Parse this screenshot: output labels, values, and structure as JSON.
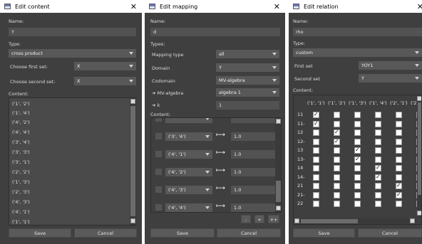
{
  "win1": {
    "title": "Edit content",
    "close": "✕",
    "name_label": "Name:",
    "name_value": "Y",
    "type_label": "Type:",
    "type_value": "cross product",
    "first_set_label": "Choose first set:",
    "first_set_value": "X",
    "second_set_label": "Choose second set:",
    "second_set_value": "X",
    "content_label": "Content:",
    "items": [
      "('1', '2')",
      "('1', '4')",
      "('4', '2')",
      "('4', '4')",
      "('3', '4')",
      "('3', '3')",
      "('3', '1')",
      "('2', '2')",
      "('1', '3')",
      "('2', '3')",
      "('4', '3')",
      "('4', '1')",
      "('1', '1')"
    ],
    "save": "Save",
    "cancel": "Cancel"
  },
  "win2": {
    "title": "Edit mapping",
    "close": "✕",
    "name_label": "Name:",
    "name_value": "d",
    "types_label": "Types:",
    "mapping_type_label": "Mapping type",
    "mapping_type_value": "all",
    "domain_label": "Domain",
    "domain_value": "Y",
    "codomain_label": "Codomain",
    "codomain_value": "MV-algebra",
    "mv_label": "➔ MV-algebra",
    "mv_value": "algebra 1",
    "k_label": "➔ k",
    "k_value": "1",
    "content_label": "Content:",
    "rows": [
      {
        "key": "('3', '4')",
        "value": "1.0"
      },
      {
        "key": "('4', '1')",
        "value": "1.0"
      },
      {
        "key": "('4', '2')",
        "value": "1.0"
      },
      {
        "key": "('4', '3')",
        "value": "1.0"
      },
      {
        "key": "('4', '4')",
        "value": "1.0"
      }
    ],
    "maps_to": "⟼",
    "minus": "-",
    "plus": "+",
    "plusplus": "++",
    "save": "Save",
    "cancel": "Cancel"
  },
  "win3": {
    "title": "Edit relation",
    "close": "✕",
    "name_label": "Name:",
    "name_value": "rho",
    "type_label": "Type:",
    "type_value": "custom",
    "first_set_label": "First set",
    "first_set_value": "YOY1",
    "second_set_label": "Second set",
    "second_set_value": "Y",
    "content_label": "Content:",
    "columns": [
      "('1', '1')",
      "('1', '2')",
      "('1', '3')",
      "('1', '4')",
      "('2', '1')",
      "('2"
    ],
    "rows": [
      {
        "label": "11",
        "checks": [
          true,
          false,
          false,
          false,
          false,
          false
        ]
      },
      {
        "label": "11-",
        "checks": [
          true,
          false,
          false,
          false,
          false,
          false
        ]
      },
      {
        "label": "12",
        "checks": [
          false,
          true,
          false,
          false,
          false,
          false
        ]
      },
      {
        "label": "12-",
        "checks": [
          false,
          true,
          false,
          false,
          false,
          false
        ]
      },
      {
        "label": "13",
        "checks": [
          false,
          false,
          true,
          false,
          false,
          false
        ]
      },
      {
        "label": "13-",
        "checks": [
          false,
          false,
          true,
          false,
          false,
          false
        ]
      },
      {
        "label": "14",
        "checks": [
          false,
          false,
          false,
          true,
          false,
          false
        ]
      },
      {
        "label": "14-",
        "checks": [
          false,
          false,
          false,
          true,
          false,
          false
        ]
      },
      {
        "label": "21",
        "checks": [
          false,
          false,
          false,
          false,
          true,
          false
        ]
      },
      {
        "label": "21-",
        "checks": [
          false,
          false,
          false,
          false,
          true,
          false
        ]
      },
      {
        "label": "22",
        "checks": [
          false,
          false,
          false,
          false,
          false,
          false
        ]
      }
    ],
    "save": "Save",
    "cancel": "Cancel"
  }
}
